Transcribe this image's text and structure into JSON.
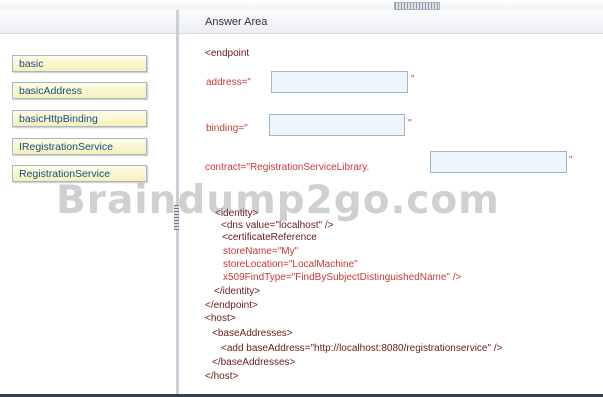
{
  "answer_area": {
    "title": "Answer Area"
  },
  "items": [
    "basic",
    "basicAddress",
    "basicHttpBinding",
    "IRegistrationService",
    "RegistrationService"
  ],
  "code": {
    "endpoint_open": "<endpoint",
    "address_attr": "address=\"",
    "binding_attr": "binding=\"",
    "contract_prefix": "contract=\"RegistrationServiceLibrary.",
    "quote": "\"",
    "identity_open": "<identity>",
    "dns": "<dns value=\"localhost\" />",
    "cert_ref": "<certificateReference",
    "store_name": "storeName=\"My\"",
    "store_location": "storeLocation=\"LocalMachine\"",
    "find_type": "x509FindType=\"FindBySubjectDistinguishedName\" />",
    "identity_close": "</identity>",
    "endpoint_close": "</endpoint>",
    "host_open": "<host>",
    "base_addresses_open": "<baseAddresses>",
    "add_base": "<add baseAddress=\"http://localhost:8080/registrationservice\" />",
    "base_addresses_close": "</baseAddresses>",
    "host_close": "</host>"
  },
  "watermark": "Braindump2go.com"
}
